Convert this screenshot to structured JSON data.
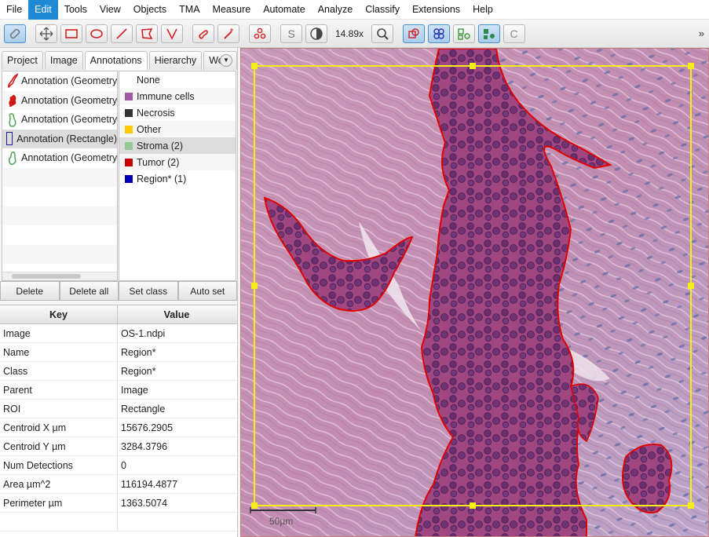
{
  "menu": [
    "File",
    "Edit",
    "Tools",
    "View",
    "Objects",
    "TMA",
    "Measure",
    "Automate",
    "Analyze",
    "Classify",
    "Extensions",
    "Help"
  ],
  "toolbar": {
    "zoom": "14.89x",
    "overflow": "»"
  },
  "tabs": [
    "Project",
    "Image",
    "Annotations",
    "Hierarchy",
    "Work"
  ],
  "annotations": [
    {
      "label": "Annotation (Geometry)",
      "icon": "red-geometry-icon"
    },
    {
      "label": "Annotation (Geometry)",
      "icon": "red-geometry-icon"
    },
    {
      "label": "Annotation (Geometry)",
      "icon": "green-geometry-icon"
    },
    {
      "label": "Annotation (Rectangle)",
      "icon": "rectangle-icon"
    },
    {
      "label": "Annotation (Geometry) (",
      "icon": "green-geometry-icon"
    }
  ],
  "classes": [
    {
      "label": "None",
      "color": ""
    },
    {
      "label": "Immune cells",
      "color": "#a05aa0"
    },
    {
      "label": "Necrosis",
      "color": "#333333"
    },
    {
      "label": "Other",
      "color": "#ffc800"
    },
    {
      "label": "Stroma (2)",
      "color": "#96c896"
    },
    {
      "label": "Tumor (2)",
      "color": "#c80000"
    },
    {
      "label": "Region* (1)",
      "color": "#0000b4"
    }
  ],
  "buttons": {
    "delete": "Delete",
    "delete_all": "Delete all",
    "set_class": "Set class",
    "auto_set": "Auto set"
  },
  "properties": {
    "key_header": "Key",
    "value_header": "Value",
    "rows": [
      {
        "key": "Image",
        "value": "OS-1.ndpi"
      },
      {
        "key": "Name",
        "value": "Region*"
      },
      {
        "key": "Class",
        "value": "Region*"
      },
      {
        "key": "Parent",
        "value": "Image"
      },
      {
        "key": "ROI",
        "value": "Rectangle"
      },
      {
        "key": "Centroid X µm",
        "value": "15676.2905"
      },
      {
        "key": "Centroid Y µm",
        "value": "3284.3796"
      },
      {
        "key": "Num Detections",
        "value": "0"
      },
      {
        "key": "Area µm^2",
        "value": "116194.4877"
      },
      {
        "key": "Perimeter µm",
        "value": "1363.5074"
      }
    ]
  },
  "viewer": {
    "scalebar": "50µm"
  },
  "colors": {
    "accent": "#1e8ad6",
    "tissue": "#c48aa8",
    "tumor_outline": "#e00000",
    "roi": "#f5ee1a"
  }
}
